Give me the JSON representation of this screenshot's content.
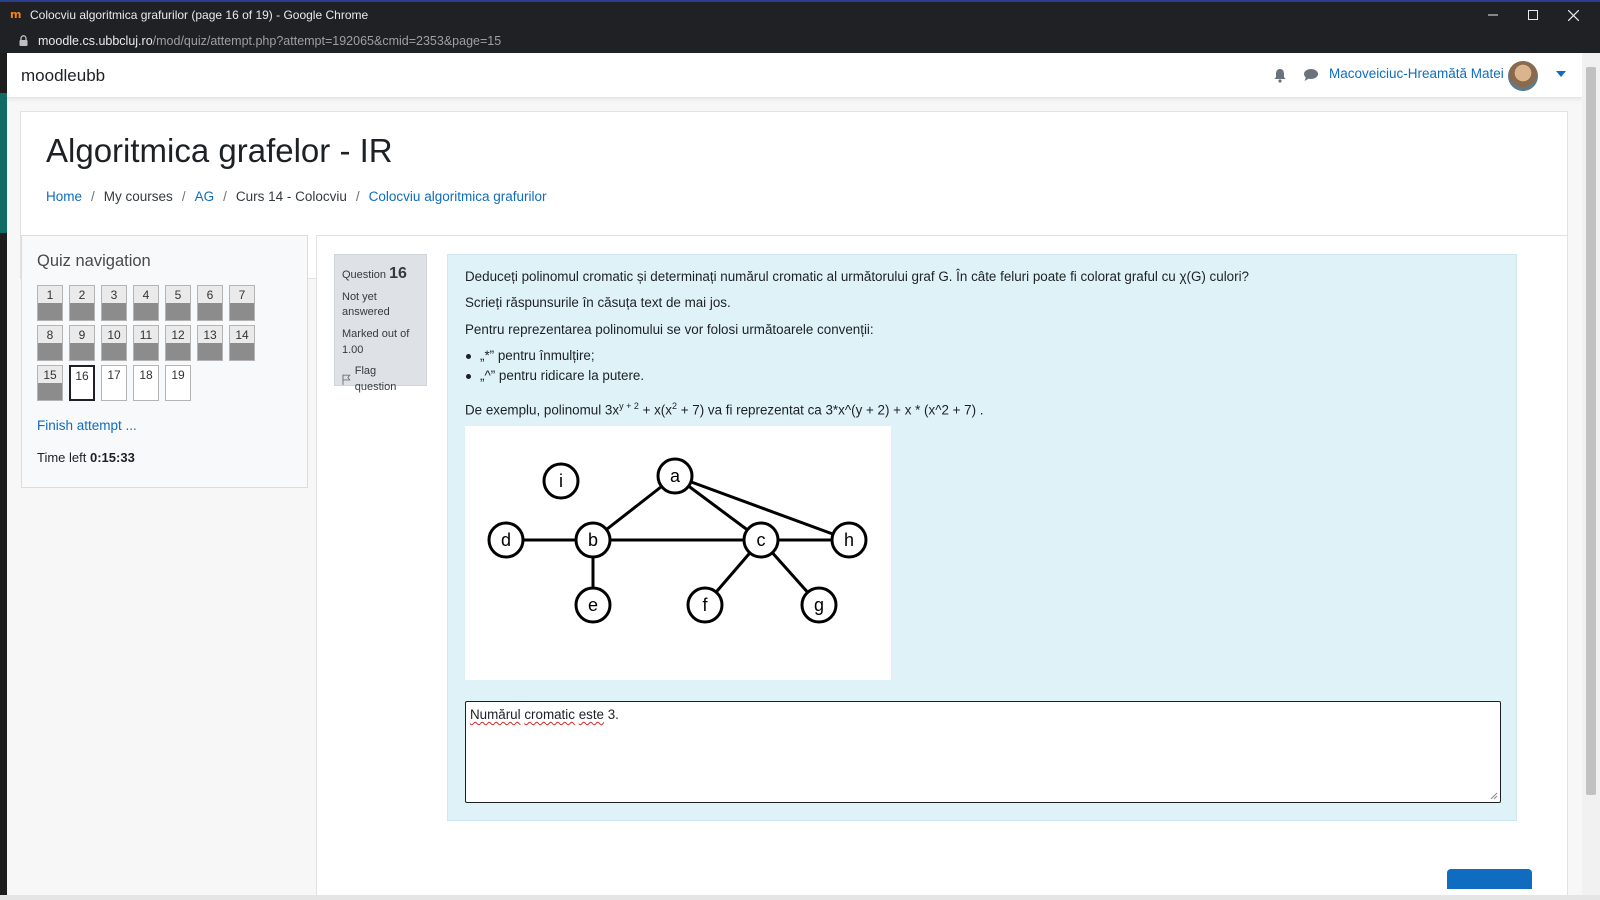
{
  "browser": {
    "title": "Colocviu algoritmica grafurilor (page 16 of 19) - Google Chrome",
    "url_host": "moodle.cs.ubbcluj.ro",
    "url_path": "/mod/quiz/attempt.php?attempt=192065&cmid=2353&page=15"
  },
  "navbar": {
    "brand": "moodleubb",
    "user_name": "Macoveiciuc-Hreamătă Matei"
  },
  "course": {
    "title": "Algoritmica grafelor - IR",
    "breadcrumb": [
      {
        "label": "Home",
        "link": true
      },
      {
        "label": "My courses",
        "link": false
      },
      {
        "label": "AG",
        "link": true
      },
      {
        "label": "Curs 14 - Colocviu",
        "link": false
      },
      {
        "label": "Colocviu algoritmica grafurilor",
        "link": true
      }
    ]
  },
  "quiz_nav": {
    "heading": "Quiz navigation",
    "questions": [
      {
        "n": "1",
        "answered": true
      },
      {
        "n": "2",
        "answered": true
      },
      {
        "n": "3",
        "answered": true
      },
      {
        "n": "4",
        "answered": true
      },
      {
        "n": "5",
        "answered": true
      },
      {
        "n": "6",
        "answered": true
      },
      {
        "n": "7",
        "answered": true
      },
      {
        "n": "8",
        "answered": true
      },
      {
        "n": "9",
        "answered": true
      },
      {
        "n": "10",
        "answered": true
      },
      {
        "n": "11",
        "answered": true
      },
      {
        "n": "12",
        "answered": true
      },
      {
        "n": "13",
        "answered": true
      },
      {
        "n": "14",
        "answered": true
      },
      {
        "n": "15",
        "answered": true
      },
      {
        "n": "16",
        "answered": false,
        "current": true
      },
      {
        "n": "17",
        "answered": false
      },
      {
        "n": "18",
        "answered": false
      },
      {
        "n": "19",
        "answered": false
      }
    ],
    "finish_label": "Finish attempt ...",
    "time_left_label": "Time left",
    "time_left_value": "0:15:33"
  },
  "question_info": {
    "question_label": "Question",
    "question_number": "16",
    "state": "Not yet answered",
    "grade": "Marked out of 1.00",
    "flag_label": "Flag question"
  },
  "question": {
    "line1": "Deduceți polinomul cromatic și determinați numărul cromatic al următorului graf G. În câte feluri poate fi colorat graful cu χ(G) culori?",
    "line2": "Scrieți răspunsurile în căsuța text de mai jos.",
    "line3": "Pentru reprezentarea polinomului se vor folosi următoarele convenții:",
    "bullet1": "„*” pentru înmulțire;",
    "bullet2": "„^” pentru ridicare la putere.",
    "example_prefix": "De exemplu, polinomul 3x",
    "example_sup1": "y + 2",
    "example_mid": " + x(x",
    "example_sup2": "2",
    "example_suffix": " + 7) va fi reprezentat ca 3*x^(y + 2) + x * (x^2 + 7) .",
    "graph_nodes": [
      "i",
      "a",
      "d",
      "b",
      "c",
      "h",
      "e",
      "f",
      "g"
    ],
    "answer_words": [
      "Numărul",
      "cromatic",
      "este",
      "3."
    ]
  },
  "colors": {
    "link": "#0f6cbf",
    "question_bg": "#def2f8",
    "nav_answered_bar": "#8c8c8c"
  }
}
